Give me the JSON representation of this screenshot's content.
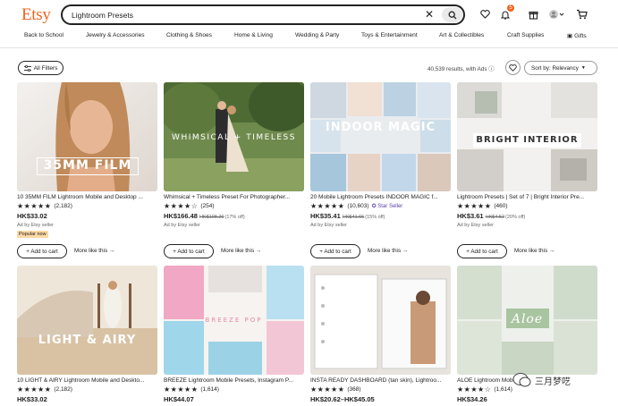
{
  "header": {
    "logo": "Etsy",
    "search_value": "Lightroom Presets",
    "notification_count": "5",
    "icons": [
      "clear-icon",
      "search-icon",
      "heart-icon",
      "bell-icon",
      "gift-icon",
      "avatar",
      "cart-icon"
    ]
  },
  "categories": [
    "Back to School",
    "Jewelry & Accessories",
    "Clothing & Shoes",
    "Home & Living",
    "Wedding & Party",
    "Toys & Entertainment",
    "Art & Collectibles",
    "Craft Supplies",
    "Gifts"
  ],
  "filters": {
    "all_filters": "All Filters",
    "results": "40,539 results, with Ads",
    "sort": "Sort by: Relevancy"
  },
  "buttons": {
    "add_to_cart": "+ Add to cart",
    "more_like_this": "More like this"
  },
  "listings": [
    {
      "overlay": "35MM FILM",
      "title": "10 35MM FILM Lightroom Mobile and Desktop ...",
      "reviews": "(2,182)",
      "price": "HK$33.02",
      "ad": "Ad by Etsy seller",
      "badge": "Popular now"
    },
    {
      "overlay": "WHIMSICAL + TIMELESS",
      "title": "Whimsical + Timeless Preset For Photographer...",
      "reviews": "(254)",
      "price": "HK$166.48",
      "old_price": "HK$198.20",
      "discount": "(17% off)",
      "ad": "Ad by Etsy seller"
    },
    {
      "overlay": "INDOOR MAGIC",
      "title": "20 Mobile Lightroom Presets INDOOR MAGIC f...",
      "reviews": "(10,603)",
      "star_seller": "Star Seller",
      "price": "HK$35.41",
      "old_price": "HK$41.66",
      "discount": "(15% off)",
      "ad": "Ad by Etsy seller"
    },
    {
      "overlay": "BRIGHT INTERIOR",
      "title": "Lightroom Presets | Set of 7 | Bright Interior Pre...",
      "reviews": "(460)",
      "price": "HK$3.61",
      "old_price": "HK$4.52",
      "discount": "(20% off)",
      "ad": "Ad by Etsy seller"
    },
    {
      "overlay": "LIGHT & AIRY",
      "title": "10 LIGHT & AIRY Lightroom Mobile and Deskto...",
      "reviews": "(2,182)",
      "price": "HK$33.02"
    },
    {
      "overlay": "BREEZE POP",
      "title": "BREEZE Lightroom Mobile Presets, Instagram P...",
      "reviews": "(1,614)",
      "price": "HK$44.07"
    },
    {
      "overlay": "",
      "title": "INSTA READY DASHBOARD (tan skin), Lightroo...",
      "reviews": "(368)",
      "price": "HK$20.62–HK$45.05"
    },
    {
      "overlay": "Aloe",
      "title": "ALOE Lightroom Mobile ...",
      "reviews": "(1,614)",
      "price": "HK$34.26"
    }
  ],
  "watermark": "三月梦呓",
  "colors": {
    "brand": "#f1641e",
    "star_seller": "#5a3fa8",
    "popular_bg": "#fdd9a4"
  }
}
